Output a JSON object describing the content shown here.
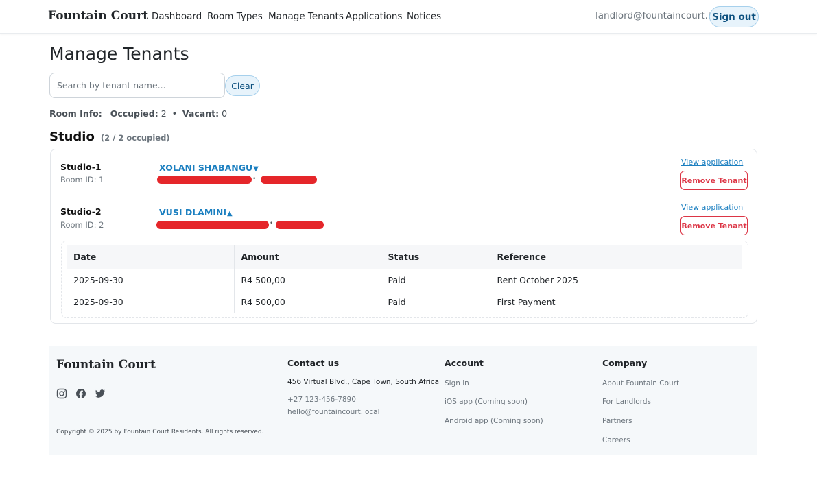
{
  "nav": {
    "brand": "Fountain Court",
    "links": [
      "Dashboard",
      "Room Types",
      "Manage Tenants",
      "Applications",
      "Notices"
    ],
    "email": "landlord@fountaincourt.local",
    "signout_label": "Sign out"
  },
  "page": {
    "title": "Manage Tenants",
    "search_placeholder": "Search by tenant name...",
    "clear_label": "Clear"
  },
  "room_info": {
    "label": "Room Info:",
    "occupied_label": "Occupied:",
    "occupied": "2",
    "vacant_label": "Vacant:",
    "vacant": "0"
  },
  "section": {
    "name": "Studio",
    "count": "(2 / 2 occupied)"
  },
  "rooms": [
    {
      "name": "Studio-1",
      "room_id": "Room ID: 1",
      "tenant": "XOLANI SHABANGU",
      "expanded": false,
      "view_label": "View application",
      "remove_label": "Remove Tenant"
    },
    {
      "name": "Studio-2",
      "room_id": "Room ID: 2",
      "tenant": "VUSI DLAMINI",
      "expanded": true,
      "view_label": "View application",
      "remove_label": "Remove Tenant"
    }
  ],
  "payments": {
    "headers": [
      "Date",
      "Amount",
      "Status",
      "Reference"
    ],
    "rows": [
      [
        "2025-09-30",
        "R4 500,00",
        "Paid",
        "Rent October 2025"
      ],
      [
        "2025-09-30",
        "R4 500,00",
        "Paid",
        "First Payment"
      ]
    ]
  },
  "footer": {
    "brand": "Fountain Court",
    "social_icons": [
      "instagram-icon",
      "facebook-icon",
      "twitter-icon"
    ],
    "copyright": "Copyright © 2025 by Fountain Court Residents. All rights reserved.",
    "contact": {
      "title": "Contact us",
      "address": "456 Virtual Blvd., Cape Town, South Africa",
      "phone": "+27 123-456-7890",
      "email": "hello@fountaincourt.local"
    },
    "account": {
      "title": "Account",
      "items": [
        "Sign in",
        "iOS app (Coming soon)",
        "Android app (Coming soon)"
      ]
    },
    "company": {
      "title": "Company",
      "items": [
        "About Fountain Court",
        "For Landlords",
        "Partners",
        "Careers"
      ]
    }
  },
  "colors": {
    "accent": "#1b7fc0",
    "danger": "#dc3545",
    "redaction": "#e5262a",
    "footer_bg": "#f5f8fa"
  }
}
